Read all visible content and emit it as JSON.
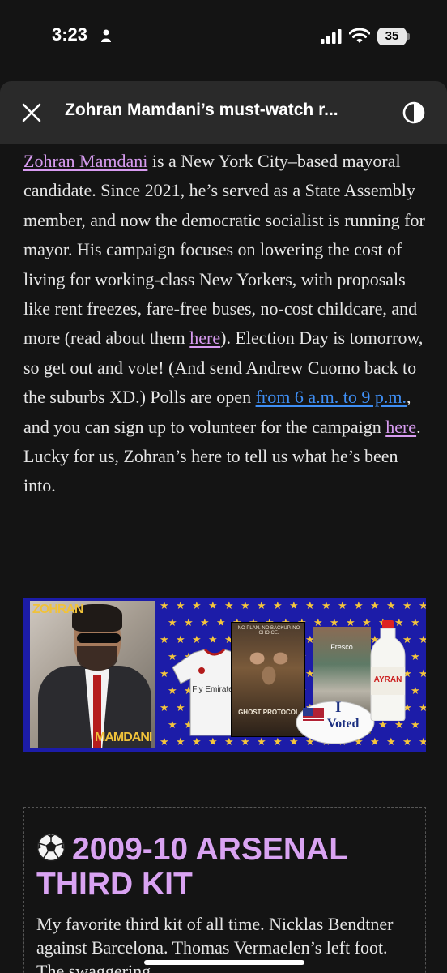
{
  "status_bar": {
    "time": "3:23",
    "battery": "35"
  },
  "toolbar": {
    "title": "Zohran Mamdani’s must-watch r..."
  },
  "article": {
    "segments": [
      {
        "text": "Zohran Mamdani",
        "link": "purple"
      },
      {
        "text": " is a New York City–based mayoral candidate. Since 2021, he’s served as a State Assembly member, and now the democratic socialist is running for mayor. His campaign focuses on lowering the cost of living for working-class New Yorkers, with proposals like rent freezes, fare-free buses, no-cost childcare, and more (read about them "
      },
      {
        "text": "here",
        "link": "purple"
      },
      {
        "text": "). Election Day is tomorrow, so get out and vote! (And send Andrew Cuomo back to the suburbs XD.) Polls are open "
      },
      {
        "text": "from 6 a.m. to 9 p.m.",
        "link": "blue"
      },
      {
        "text": ", and you can sign up to volunteer for the campaign "
      },
      {
        "text": "here",
        "link": "purple"
      },
      {
        "text": ". Lucky for us, Zohran’s here to tell us what he’s been into."
      }
    ],
    "banner": {
      "photo_top_label": "ZOHRAN",
      "photo_bottom_label": "MAMDANI",
      "jersey_text": "Fly Emirates",
      "poster_tagline": "NO PLAN. NO BACKUP. NO CHOICE.",
      "poster_title": "GHOST PROTOCOL",
      "store_sign": "Fresco",
      "sticker_line1": "I",
      "sticker_line2": "Voted",
      "bottle_label": "AYRAN"
    },
    "card": {
      "heading": "2009-10 ARSENAL THIRD KIT",
      "body": "My favorite third kit of all time. Nicklas Bendtner against Barcelona. Thomas Vermaelen’s left foot. The swaggering"
    }
  },
  "colors": {
    "link_purple": "#d79bf0",
    "link_blue": "#3f8ff5",
    "heading_purple": "#d9a3f2",
    "banner_blue": "#1c1ca8",
    "star_yellow": "#f5c63c"
  },
  "icons": {
    "close": "close-icon",
    "contrast": "contrast-icon",
    "soccer_ball": "soccer-ball-icon"
  }
}
